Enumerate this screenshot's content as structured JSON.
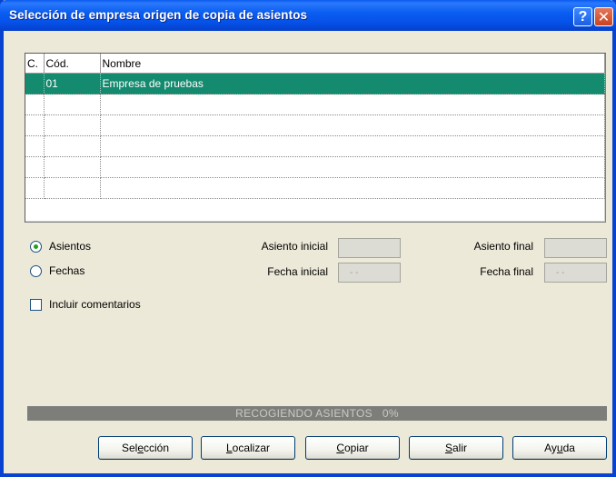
{
  "window": {
    "title": "Selección de empresa origen de copia de asientos",
    "help_glyph": "?",
    "close_glyph": "✕"
  },
  "grid": {
    "columns": [
      "C.",
      "Cód.",
      "Nombre"
    ],
    "rows": [
      {
        "c": "",
        "cod": "01",
        "nombre": "Empresa de pruebas",
        "selected": true
      },
      {
        "c": "",
        "cod": "",
        "nombre": ""
      },
      {
        "c": "",
        "cod": "",
        "nombre": ""
      },
      {
        "c": "",
        "cod": "",
        "nombre": ""
      },
      {
        "c": "",
        "cod": "",
        "nombre": ""
      },
      {
        "c": "",
        "cod": "",
        "nombre": ""
      }
    ]
  },
  "options": {
    "asientos_label": "Asientos",
    "fechas_label": "Fechas",
    "selected": "Asientos",
    "incluir_comentarios_label": "Incluir comentarios",
    "incluir_comentarios_checked": false
  },
  "range": {
    "asiento_inicial_label": "Asiento inicial",
    "asiento_inicial_value": "",
    "asiento_final_label": "Asiento final",
    "asiento_final_value": "",
    "fecha_inicial_label": "Fecha inicial",
    "fecha_inicial_value": "- -",
    "fecha_final_label": "Fecha final",
    "fecha_final_value": "- -"
  },
  "progress": {
    "text": "RECOGIENDO ASIENTOS   0%",
    "percent": 0
  },
  "buttons": {
    "seleccion": {
      "pre": "Sel",
      "key": "e",
      "post": "cción"
    },
    "localizar": {
      "pre": "",
      "key": "L",
      "post": "ocalizar"
    },
    "copiar": {
      "pre": "",
      "key": "C",
      "post": "opiar"
    },
    "salir": {
      "pre": "",
      "key": "S",
      "post": "alir"
    },
    "ayuda": {
      "pre": "Ay",
      "key": "u",
      "post": "da"
    }
  },
  "colors": {
    "titlebar": "#0a5bf0",
    "selected_row": "#148a6e",
    "progress_bar": "#7d7e7a"
  }
}
